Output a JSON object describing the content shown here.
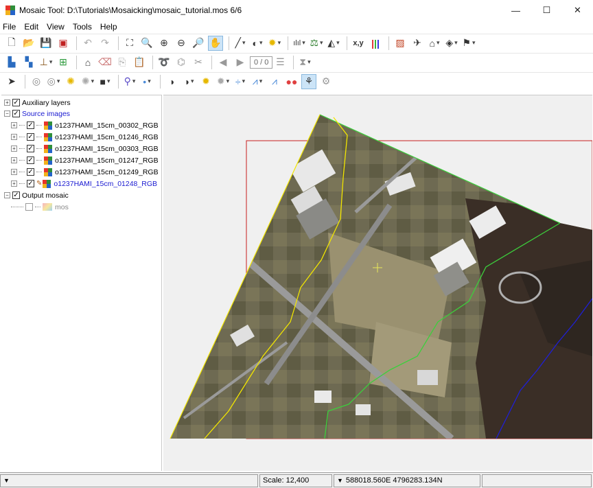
{
  "window": {
    "title": "Mosaic Tool: D:\\Tutorials\\Mosaicking\\mosaic_tutorial.mos 6/6",
    "minimize": "—",
    "maximize": "☐",
    "close": "✕"
  },
  "menu": [
    "File",
    "Edit",
    "View",
    "Tools",
    "Help"
  ],
  "toolbar2": {
    "page_current": "0",
    "page_total": "0"
  },
  "tree": {
    "auxiliary": "Auxiliary layers",
    "source": "Source images",
    "images": [
      "o1237HAMI_15cm_00302_RGB",
      "o1237HAMI_15cm_01246_RGB",
      "o1237HAMI_15cm_00303_RGB",
      "o1237HAMI_15cm_01247_RGB",
      "o1237HAMI_15cm_01249_RGB",
      "o1237HAMI_15cm_01248_RGB"
    ],
    "output": "Output mosaic",
    "mosaic": "mos"
  },
  "status": {
    "scale": "Scale: 12,400",
    "coords": "588018.560E 4796283.134N"
  },
  "colors": {
    "accent_blue": "#1a1ad1",
    "seam_yellow": "#f2e600",
    "seam_green": "#3ccf3c",
    "seam_blue": "#1f1fd6",
    "extent_red": "#c81e1e"
  }
}
